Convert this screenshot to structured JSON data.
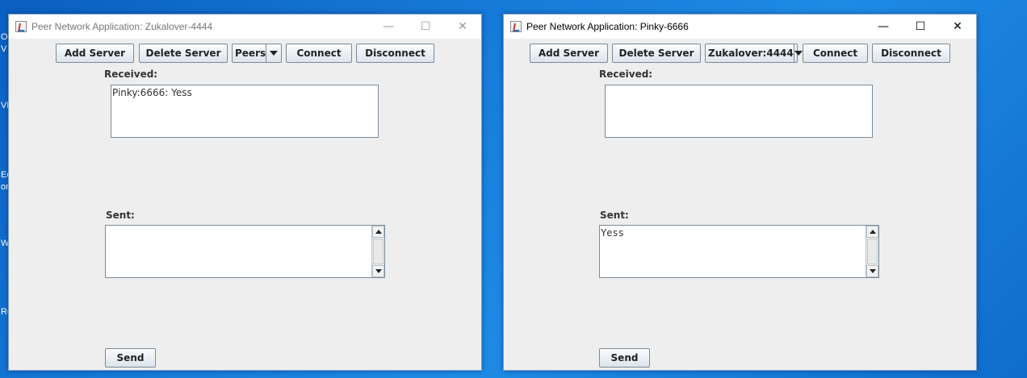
{
  "desktop": {
    "icon_labels": [
      "O",
      "V",
      "VL",
      "Ec",
      "or",
      "Wi",
      "Re"
    ]
  },
  "window_left": {
    "title": "Peer Network Application: Zukalover-4444",
    "toolbar": {
      "add_server": "Add Server",
      "delete_server": "Delete Server",
      "peers_selected": "Peers",
      "connect": "Connect",
      "disconnect": "Disconnect"
    },
    "received_label": "Received:",
    "received_text": "Pinky:6666: Yess",
    "sent_label": "Sent:",
    "sent_text": "",
    "send": "Send",
    "controls": {
      "minimize": "—",
      "maximize": "☐",
      "close": "✕"
    }
  },
  "window_right": {
    "title": "Peer Network Application: Pinky-6666",
    "toolbar": {
      "add_server": "Add Server",
      "delete_server": "Delete Server",
      "peers_selected": "Zukalover:4444",
      "connect": "Connect",
      "disconnect": "Disconnect"
    },
    "received_label": "Received:",
    "received_text": "",
    "sent_label": "Sent:",
    "sent_text": "Yess",
    "send": "Send",
    "controls": {
      "minimize": "—",
      "maximize": "☐",
      "close": "✕"
    }
  }
}
